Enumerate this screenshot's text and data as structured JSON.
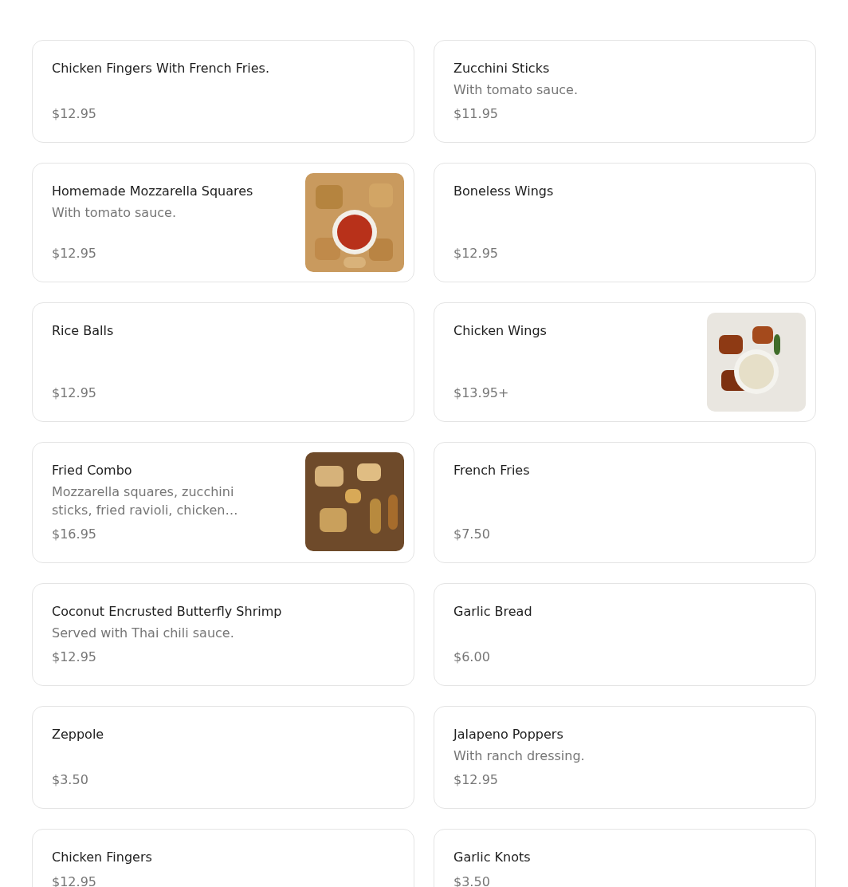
{
  "items": [
    {
      "name": "Chicken Fingers With French Fries.",
      "price": "$12.95",
      "picture": false
    },
    {
      "name": "Zucchini Sticks",
      "description": "With tomato sauce.",
      "price": "$11.95",
      "picture": false
    },
    {
      "name": "Homemade Mozzarella Squares",
      "description": "With tomato sauce.",
      "price": "$12.95",
      "picture": true
    },
    {
      "name": "Boneless Wings",
      "price": "$12.95",
      "picture": false
    },
    {
      "name": "Rice Balls",
      "price": "$12.95",
      "picture": false
    },
    {
      "name": "Chicken Wings",
      "price": "$13.95+",
      "picture": true
    },
    {
      "name": "Fried Combo",
      "description": "Mozzarella squares, zucchini sticks, fried ravioli, chicken…",
      "price": "$16.95",
      "picture": true
    },
    {
      "name": "French Fries",
      "price": "$7.50",
      "picture": false
    },
    {
      "name": "Coconut Encrusted Butterfly Shrimp",
      "description": "Served with Thai chili sauce.",
      "price": "$12.95",
      "picture": false
    },
    {
      "name": "Garlic Bread",
      "price": "$6.00",
      "picture": false
    },
    {
      "name": "Zeppole",
      "price": "$3.50",
      "picture": false
    },
    {
      "name": "Jalapeno Poppers",
      "description": "With ranch dressing.",
      "price": "$12.95",
      "picture": false
    },
    {
      "name": "Chicken Fingers",
      "price": "$12.95",
      "picture": false
    },
    {
      "name": "Garlic Knots",
      "price": "$3.50",
      "picture": false
    }
  ]
}
